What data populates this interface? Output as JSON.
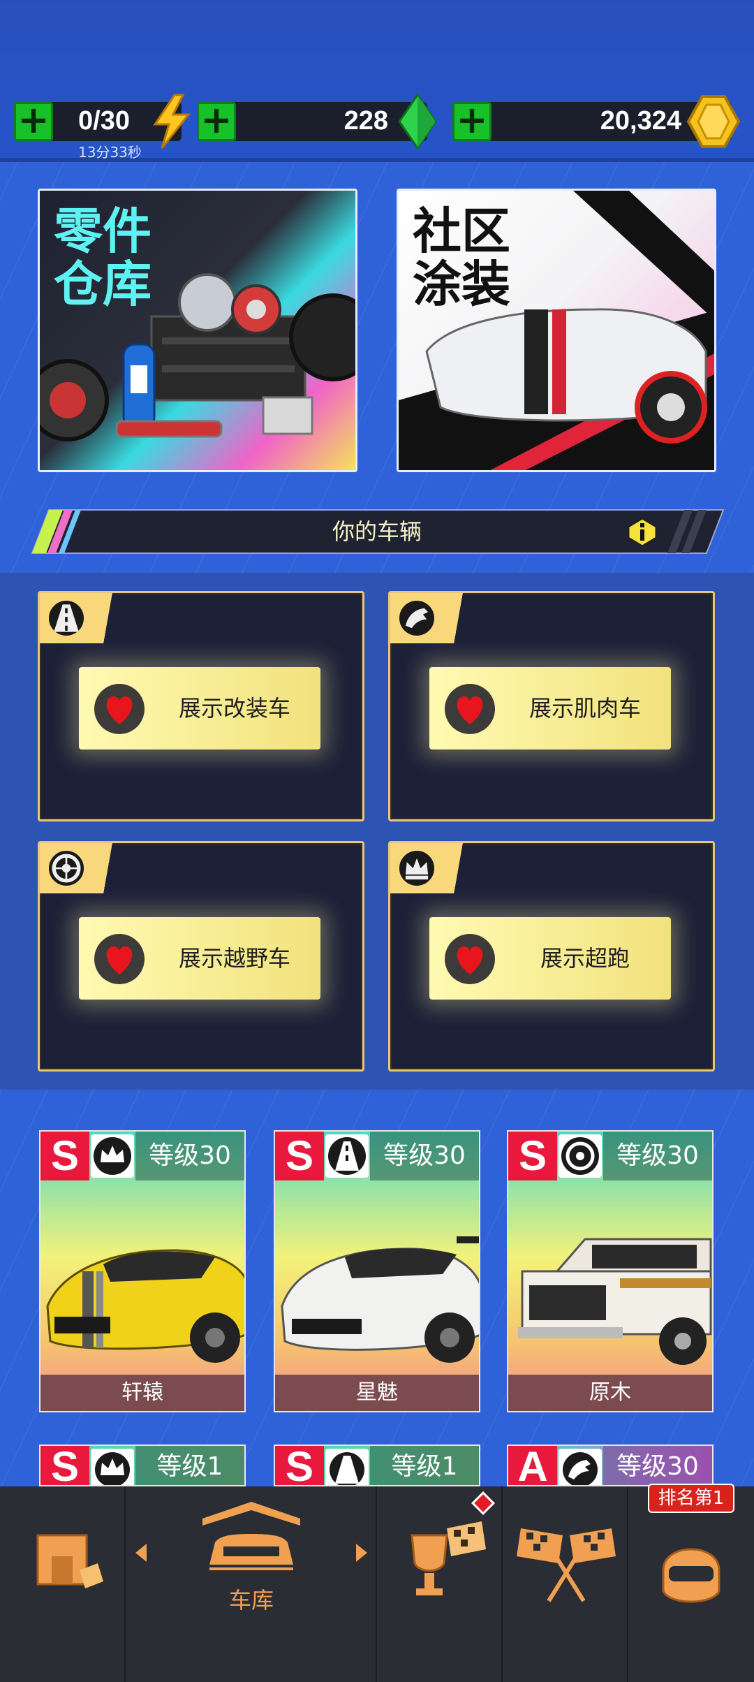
{
  "resources": {
    "energy": {
      "value": "0/30",
      "timer": "13分33秒",
      "icon": "lightning-icon"
    },
    "gems": {
      "value": "228",
      "icon": "gem-icon"
    },
    "coins": {
      "value": "20,324",
      "icon": "coin-icon"
    },
    "plus_icon": "plus-icon"
  },
  "promos": [
    {
      "title": "零件仓库",
      "line1": "零件",
      "line2": "仓库"
    },
    {
      "title": "社区涂装",
      "line1": "社区",
      "line2": "涂装"
    }
  ],
  "vehicles_banner": {
    "label": "你的车辆",
    "icon": "info-icon"
  },
  "showcases": [
    {
      "label": "展示改装车",
      "icon": "road-icon"
    },
    {
      "label": "展示肌肉车",
      "icon": "horse-icon"
    },
    {
      "label": "展示越野车",
      "icon": "tire-icon"
    },
    {
      "label": "展示超跑",
      "icon": "crown-icon"
    }
  ],
  "cars": [
    {
      "rank": "S",
      "level": "等级30",
      "name": "轩辕",
      "class_icon": "crown-icon"
    },
    {
      "rank": "S",
      "level": "等级30",
      "name": "星魅",
      "class_icon": "road-icon"
    },
    {
      "rank": "S",
      "level": "等级30",
      "name": "原木",
      "class_icon": "tire-icon"
    }
  ],
  "cars_row2": [
    {
      "rank": "S",
      "level": "等级1",
      "class_icon": "crown-icon"
    },
    {
      "rank": "S",
      "level": "等级1",
      "class_icon": "road-icon"
    },
    {
      "rank": "A",
      "level": "等级30",
      "class_icon": "horse-icon"
    }
  ],
  "nav": {
    "garage_label": "车库",
    "rank_badge": "排名第1",
    "items": [
      "shop-icon",
      "garage-icon",
      "trophy-icon",
      "race-flags-icon",
      "helmet-icon"
    ]
  },
  "colors": {
    "accent": "#f0a050",
    "plus": "#18c02a",
    "rank_s": "#e8193d",
    "gold": "#f8d87b"
  }
}
